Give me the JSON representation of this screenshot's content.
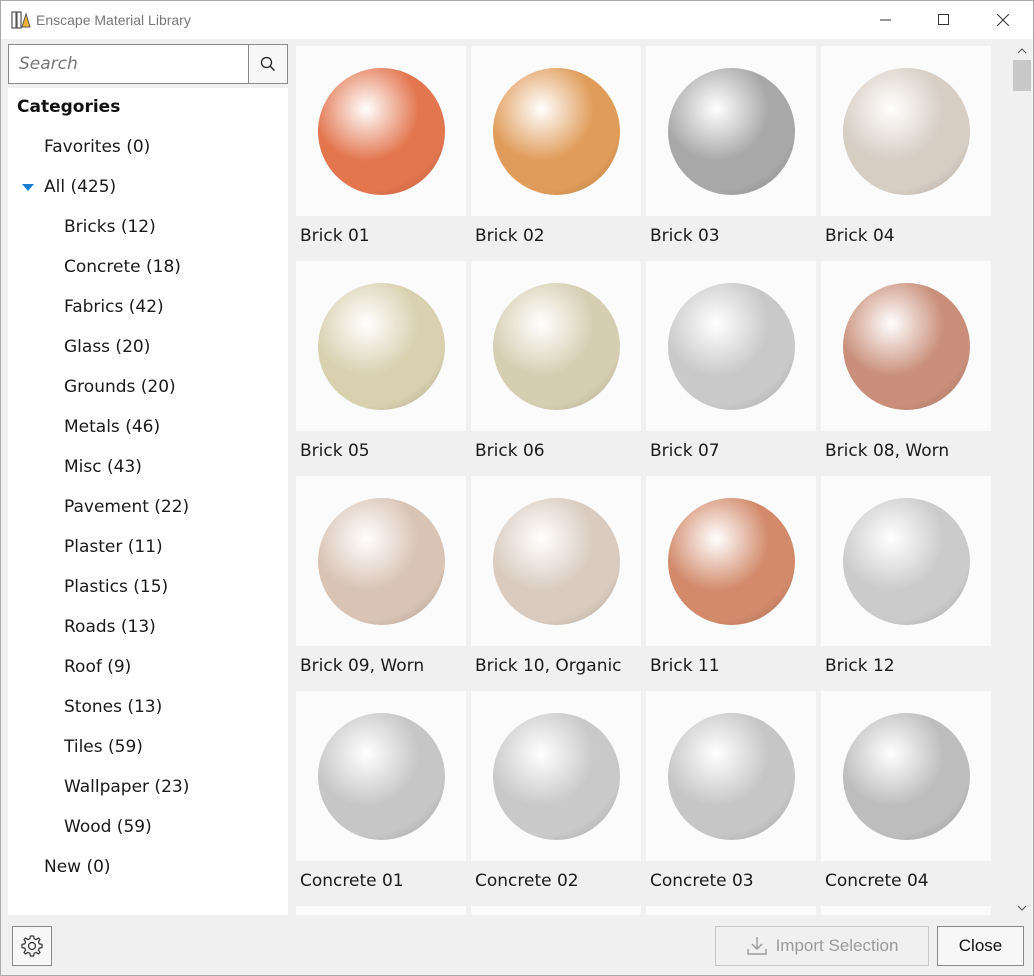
{
  "window": {
    "title": "Enscape Material Library"
  },
  "search": {
    "placeholder": "Search"
  },
  "sidebar": {
    "heading": "Categories",
    "favorites": "Favorites (0)",
    "all": "All (425)",
    "categories": [
      "Bricks (12)",
      "Concrete (18)",
      "Fabrics (42)",
      "Glass (20)",
      "Grounds (20)",
      "Metals (46)",
      "Misc (43)",
      "Pavement (22)",
      "Plaster (11)",
      "Plastics (15)",
      "Roads (13)",
      "Roof (9)",
      "Stones (13)",
      "Tiles (59)",
      "Wallpaper (23)",
      "Wood (59)"
    ],
    "new": "New (0)"
  },
  "materials": [
    {
      "label": "Brick 01",
      "color": "#e3764f"
    },
    {
      "label": "Brick 02",
      "color": "#e09c5a"
    },
    {
      "label": "Brick 03",
      "color": "#a8a8a8"
    },
    {
      "label": "Brick 04",
      "color": "#d6cdc3"
    },
    {
      "label": "Brick 05",
      "color": "#d9d0b0"
    },
    {
      "label": "Brick 06",
      "color": "#d6ceb2"
    },
    {
      "label": "Brick 07",
      "color": "#c9c9c9"
    },
    {
      "label": "Brick 08, Worn",
      "color": "#c98f7a"
    },
    {
      "label": "Brick 09, Worn",
      "color": "#d8c3b4"
    },
    {
      "label": "Brick 10, Organic",
      "color": "#d9cbbf"
    },
    {
      "label": "Brick 11",
      "color": "#d28a6b"
    },
    {
      "label": "Brick 12",
      "color": "#cbcbcb"
    },
    {
      "label": "Concrete 01",
      "color": "#c6c6c6"
    },
    {
      "label": "Concrete 02",
      "color": "#c9c9c9"
    },
    {
      "label": "Concrete 03",
      "color": "#c6c6c6"
    },
    {
      "label": "Concrete 04",
      "color": "#bdbdbd"
    }
  ],
  "footer": {
    "import_label": "Import Selection",
    "close_label": "Close"
  }
}
